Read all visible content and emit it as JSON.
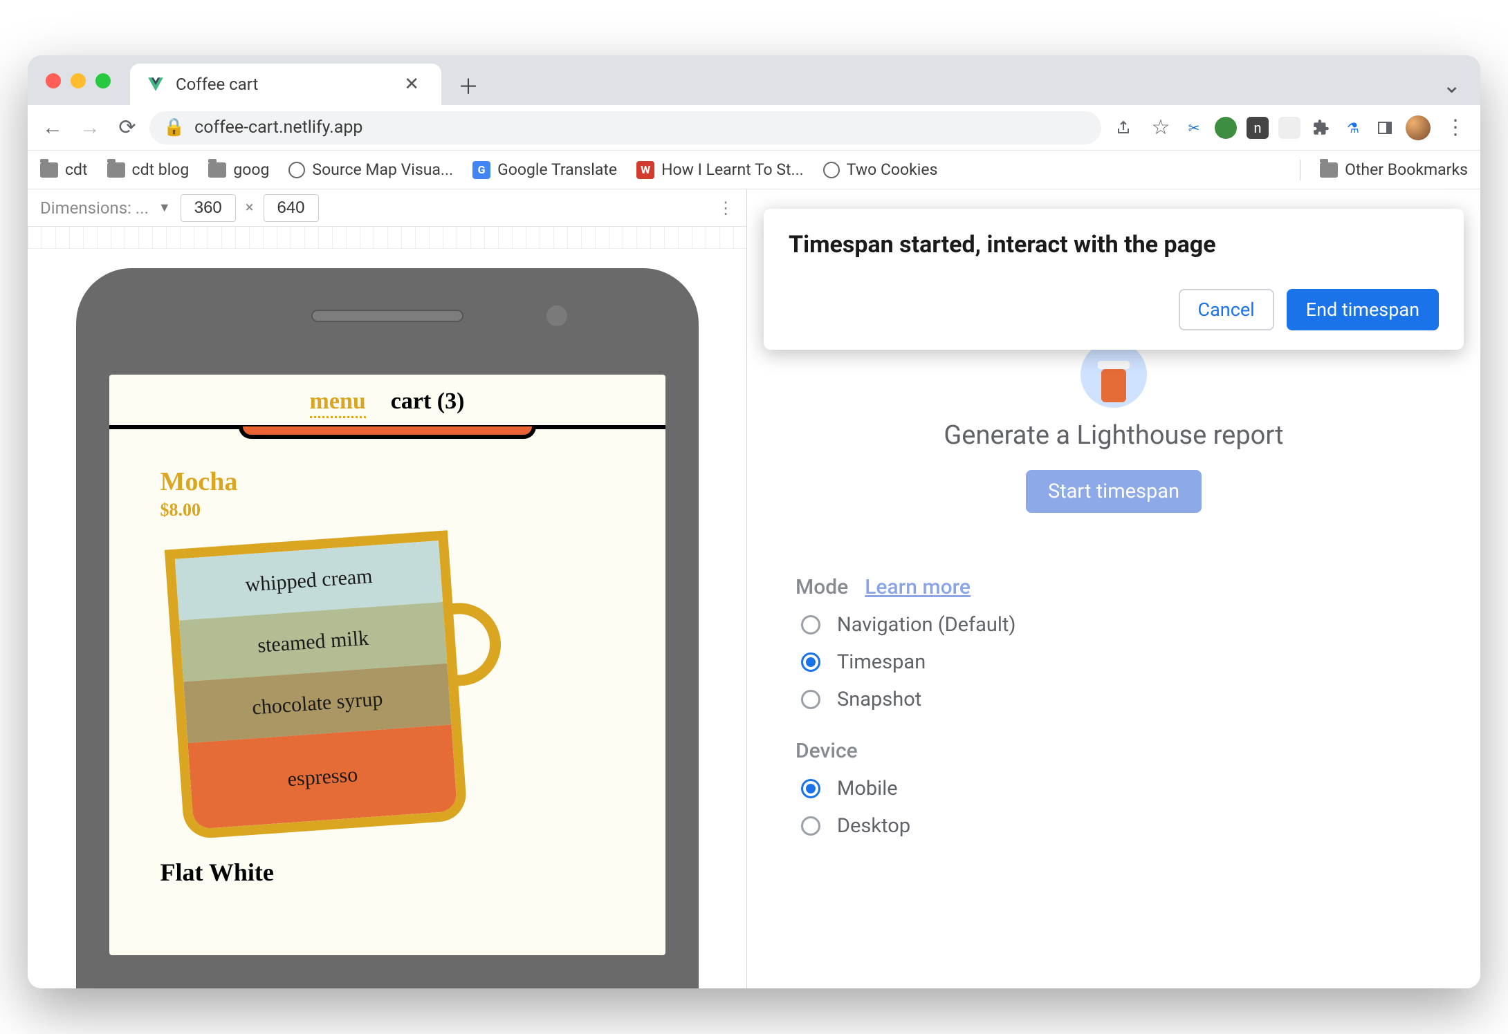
{
  "tab": {
    "title": "Coffee cart"
  },
  "address": {
    "url": "coffee-cart.netlify.app"
  },
  "bookmarks": {
    "items": [
      "cdt",
      "cdt blog",
      "goog",
      "Source Map Visua...",
      "Google Translate",
      "How I Learnt To St...",
      "Two Cookies"
    ],
    "other": "Other Bookmarks"
  },
  "device": {
    "dimensions_label": "Dimensions: ...",
    "width": "360",
    "height": "640"
  },
  "app": {
    "nav_menu": "menu",
    "nav_cart": "cart (3)",
    "product1": {
      "name": "Mocha",
      "price": "$8.00",
      "layers": [
        "whipped cream",
        "steamed milk",
        "chocolate syrup",
        "espresso"
      ]
    },
    "product2_name": "Flat White"
  },
  "dialog": {
    "title": "Timespan started, interact with the page",
    "cancel": "Cancel",
    "end": "End timespan"
  },
  "lighthouse": {
    "heading": "Generate a Lighthouse report",
    "start": "Start timespan",
    "mode_label": "Mode",
    "learn_more": "Learn more",
    "modes": [
      "Navigation (Default)",
      "Timespan",
      "Snapshot"
    ],
    "mode_selected": 1,
    "device_label": "Device",
    "devices": [
      "Mobile",
      "Desktop"
    ],
    "device_selected": 0
  }
}
